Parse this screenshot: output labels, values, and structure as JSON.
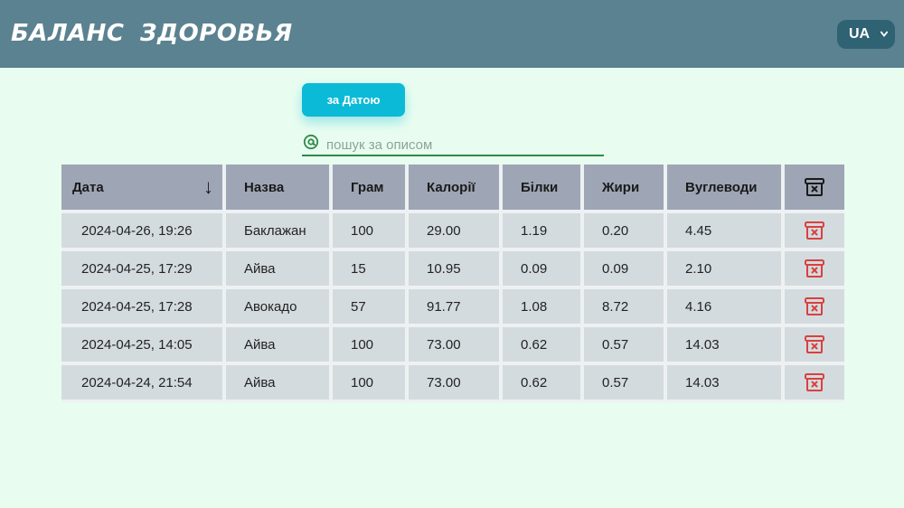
{
  "header": {
    "title": "БАЛАНС ЗДОРОВЬЯ",
    "language": "UA"
  },
  "controls": {
    "sort_label": "за Датою",
    "search_placeholder": "пошук за описом"
  },
  "table": {
    "columns": [
      "Дата",
      "Назва",
      "Грам",
      "Калорії",
      "Білки",
      "Жири",
      "Вуглеводи"
    ],
    "sort_indicator": "↓",
    "rows": [
      {
        "date": "2024-04-26, 19:26",
        "name": "Баклажан",
        "grams": "100",
        "calories": "29.00",
        "protein": "1.19",
        "fat": "0.20",
        "carbs": "4.45"
      },
      {
        "date": "2024-04-25, 17:29",
        "name": "Айва",
        "grams": "15",
        "calories": "10.95",
        "protein": "0.09",
        "fat": "0.09",
        "carbs": "2.10"
      },
      {
        "date": "2024-04-25, 17:28",
        "name": "Авокадо",
        "grams": "57",
        "calories": "91.77",
        "protein": "1.08",
        "fat": "8.72",
        "carbs": "4.16"
      },
      {
        "date": "2024-04-25, 14:05",
        "name": "Айва",
        "grams": "100",
        "calories": "73.00",
        "protein": "0.62",
        "fat": "0.57",
        "carbs": "14.03"
      },
      {
        "date": "2024-04-24, 21:54",
        "name": "Айва",
        "grams": "100",
        "calories": "73.00",
        "protein": "0.62",
        "fat": "0.57",
        "carbs": "14.03"
      }
    ]
  },
  "icons": {
    "header_delete": "archive-x-icon",
    "row_delete": "delete-icon",
    "search": "at-sign-icon",
    "language_dropdown": "chevron-down-icon"
  },
  "colors": {
    "header_bg": "#5b8290",
    "page_bg": "#e8fdf0",
    "accent": "#0bbad6",
    "delete_red": "#d9413e",
    "search_green": "#2e8a47"
  }
}
